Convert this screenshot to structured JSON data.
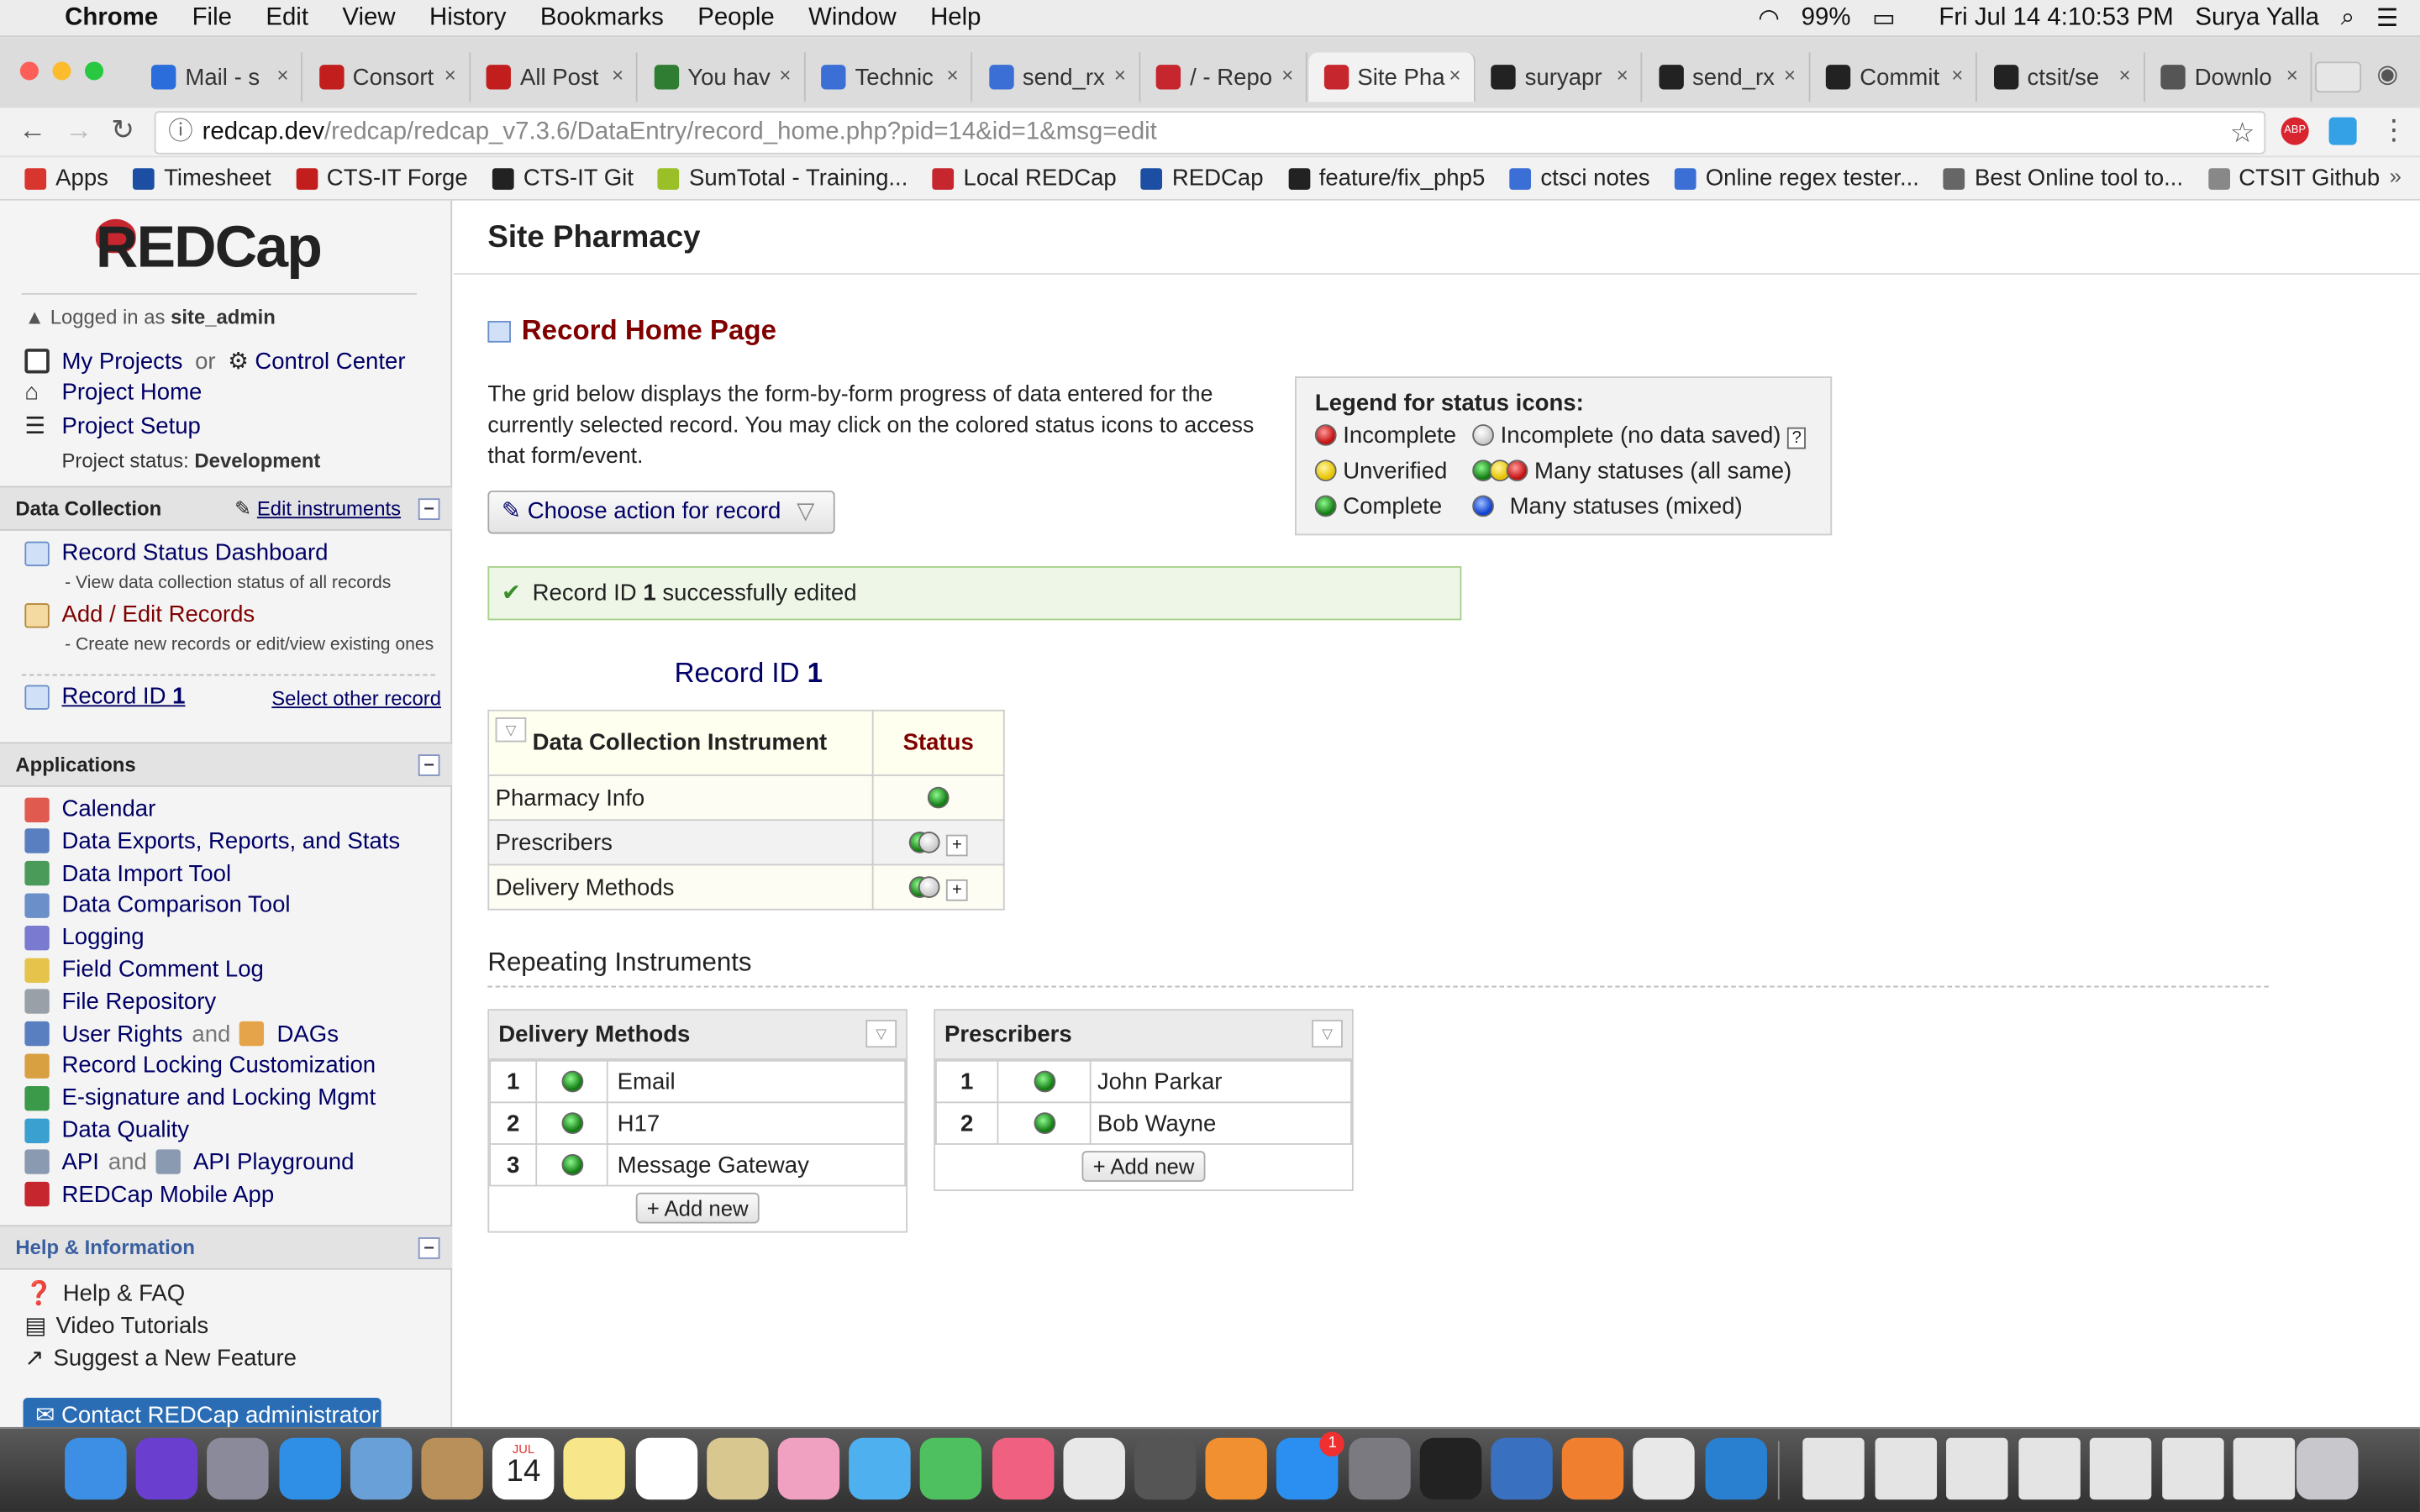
{
  "menubar": {
    "app": "Chrome",
    "items": [
      "File",
      "Edit",
      "View",
      "History",
      "Bookmarks",
      "People",
      "Window",
      "Help"
    ],
    "battery": "99%",
    "datetime": "Fri Jul 14  4:10:53 PM",
    "user": "Surya Yalla"
  },
  "tabs": [
    "Mail - s",
    "Consort",
    "All Post",
    "You hav",
    "Technic",
    "send_rx",
    "/ - Repo",
    "Site Pha",
    "suryapr",
    "send_rx",
    "Commit",
    "ctsit/se",
    "Downlo"
  ],
  "url": {
    "host": "redcap.dev",
    "path": "/redcap/redcap_v7.3.6/DataEntry/record_home.php?pid=14&id=1&msg=edit"
  },
  "bookmarks": [
    "Apps",
    "Timesheet",
    "CTS-IT Forge",
    "CTS-IT Git",
    "SumTotal - Training...",
    "Local REDCap",
    "REDCap",
    "feature/fix_php5",
    "ctsci notes",
    "Online regex tester...",
    "Best Online tool to...",
    "CTSIT Github"
  ],
  "sidebar": {
    "logo": "REDCap",
    "logged_in_prefix": "Logged in as",
    "logged_in_user": "site_admin",
    "my_projects": "My Projects",
    "or": "or",
    "control_center": "Control Center",
    "project_home": "Project Home",
    "project_setup": "Project Setup",
    "status_label": "Project status:",
    "status_value": "Development",
    "data_collection": "Data Collection",
    "edit_instruments": "Edit instruments",
    "rsd": "Record Status Dashboard",
    "rsd_sub": "- View data collection status of all records",
    "aer": "Add / Edit Records",
    "aer_sub": "- Create new records or edit/view existing ones",
    "record_prefix": "Record ID",
    "record_id": "1",
    "select_other": "Select other record",
    "applications": "Applications",
    "apps": [
      "Calendar",
      "Data Exports, Reports, and Stats",
      "Data Import Tool",
      "Data Comparison Tool",
      "Logging",
      "Field Comment Log",
      "File Repository"
    ],
    "user_rights": "User Rights",
    "and": "and",
    "dags": "DAGs",
    "apps2": [
      "Record Locking Customization",
      "E-signature and Locking Mgmt",
      "Data Quality"
    ],
    "api": "API",
    "api_playground": "API Playground",
    "mobile": "REDCap Mobile App",
    "help_info": "Help & Information",
    "help": [
      "Help & FAQ",
      "Video Tutorials",
      "Suggest a New Feature"
    ],
    "contact": "Contact REDCap administrator"
  },
  "main": {
    "title": "Site Pharmacy",
    "heading": "Record Home Page",
    "intro": "The grid below displays the form-by-form progress of data entered for the currently selected record. You may click on the colored status icons to access that form/event.",
    "action": "Choose action for record",
    "success_pre": "Record ID",
    "success_id": "1",
    "success_post": "successfully edited",
    "legend": {
      "title": "Legend for status icons:",
      "incomplete": "Incomplete",
      "incomplete_nodata": "Incomplete (no data saved)",
      "unverified": "Unverified",
      "many_same": "Many statuses (all same)",
      "complete": "Complete",
      "many_mixed": "Many statuses (mixed)",
      "help": "?"
    },
    "record_label": "Record ID",
    "record_id": "1",
    "grid_col1": "Data Collection Instrument",
    "grid_col2": "Status",
    "instruments": [
      "Pharmacy Info",
      "Prescribers",
      "Delivery Methods"
    ],
    "repeating": "Repeating Instruments",
    "delivery": {
      "title": "Delivery Methods",
      "rows": [
        [
          "1",
          "Email"
        ],
        [
          "2",
          "H17"
        ],
        [
          "3",
          "Message Gateway"
        ]
      ]
    },
    "prescribers": {
      "title": "Prescribers",
      "rows": [
        [
          "1",
          "John Parkar"
        ],
        [
          "2",
          "Bob Wayne"
        ]
      ]
    },
    "add_new": "+ Add new"
  },
  "dock_calendar": {
    "month": "JUL",
    "day": "14"
  },
  "badge": "1"
}
